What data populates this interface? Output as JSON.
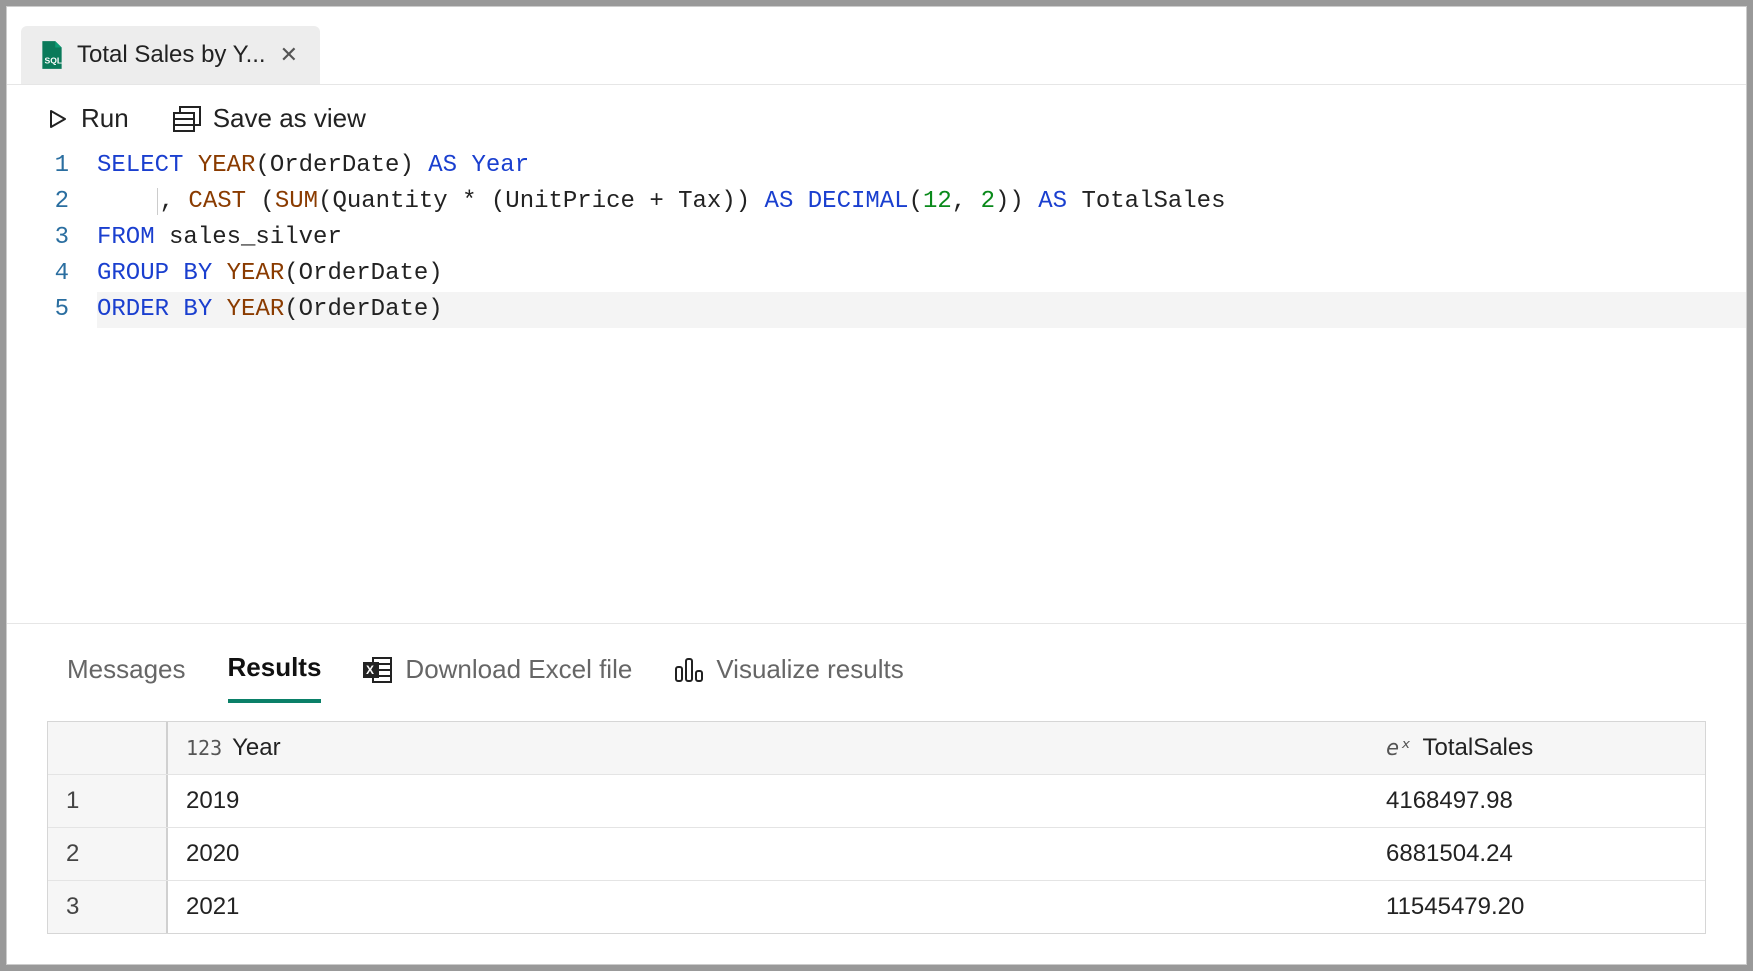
{
  "tab": {
    "label": "Total Sales by Y..."
  },
  "toolbar": {
    "run": "Run",
    "save_as_view": "Save as view"
  },
  "editor": {
    "lines": [
      "1",
      "2",
      "3",
      "4",
      "5"
    ],
    "raw_sql": "SELECT YEAR(OrderDate) AS Year\n    , CAST (SUM(Quantity * (UnitPrice + Tax)) AS DECIMAL(12, 2)) AS TotalSales\nFROM sales_silver\nGROUP BY YEAR(OrderDate)\nORDER BY YEAR(OrderDate)"
  },
  "results_tabs": {
    "messages": "Messages",
    "results": "Results",
    "download": "Download Excel file",
    "visualize": "Visualize results"
  },
  "results": {
    "columns": [
      {
        "type_icon": "123",
        "name": "Year"
      },
      {
        "type_icon": "eˣ",
        "name": "TotalSales"
      }
    ],
    "rows": [
      {
        "n": "1",
        "Year": "2019",
        "TotalSales": "4168497.98"
      },
      {
        "n": "2",
        "Year": "2020",
        "TotalSales": "6881504.24"
      },
      {
        "n": "3",
        "Year": "2021",
        "TotalSales": "11545479.20"
      }
    ]
  },
  "chart_data": {
    "type": "table",
    "columns": [
      "Year",
      "TotalSales"
    ],
    "rows": [
      [
        "2019",
        4168497.98
      ],
      [
        "2020",
        6881504.24
      ],
      [
        "2021",
        11545479.2
      ]
    ]
  }
}
